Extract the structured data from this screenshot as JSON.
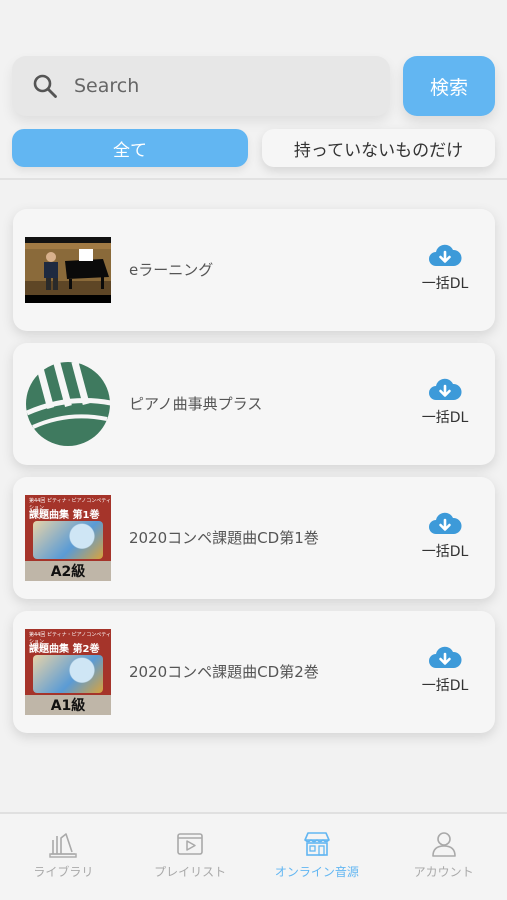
{
  "search": {
    "placeholder": "Search",
    "button_label": "検索"
  },
  "filters": {
    "all_label": "全て",
    "not_owned_label": "持っていないものだけ"
  },
  "items": [
    {
      "title": "eラーニング",
      "action_label": "一括DL",
      "thumb": "pianist-video-thumbnail"
    },
    {
      "title": "ピアノ曲事典プラス",
      "action_label": "一括DL",
      "thumb": "green-piano-key-logo"
    },
    {
      "title": "2020コンペ課題曲CD第1巻",
      "action_label": "一括DL",
      "thumb": "cd-cover-a2",
      "cover_header": "第44回 ピティナ・ピアノコンペティション",
      "cover_title": "課題曲集 第1巻",
      "cover_grade": "A2級"
    },
    {
      "title": "2020コンペ課題曲CD第2巻",
      "action_label": "一括DL",
      "thumb": "cd-cover-a1",
      "cover_header": "第44回 ピティナ・ピアノコンペティション",
      "cover_title": "課題曲集 第2巻",
      "cover_grade": "A1級"
    }
  ],
  "nav": [
    {
      "label": "ライブラリ",
      "icon": "library-icon",
      "active": false
    },
    {
      "label": "プレイリスト",
      "icon": "playlist-icon",
      "active": false
    },
    {
      "label": "オンライン音源",
      "icon": "store-icon",
      "active": true
    },
    {
      "label": "アカウント",
      "icon": "account-icon",
      "active": false
    }
  ],
  "colors": {
    "accent": "#62b6f2",
    "background": "#f2f2f2",
    "card": "#f6f6f6"
  }
}
